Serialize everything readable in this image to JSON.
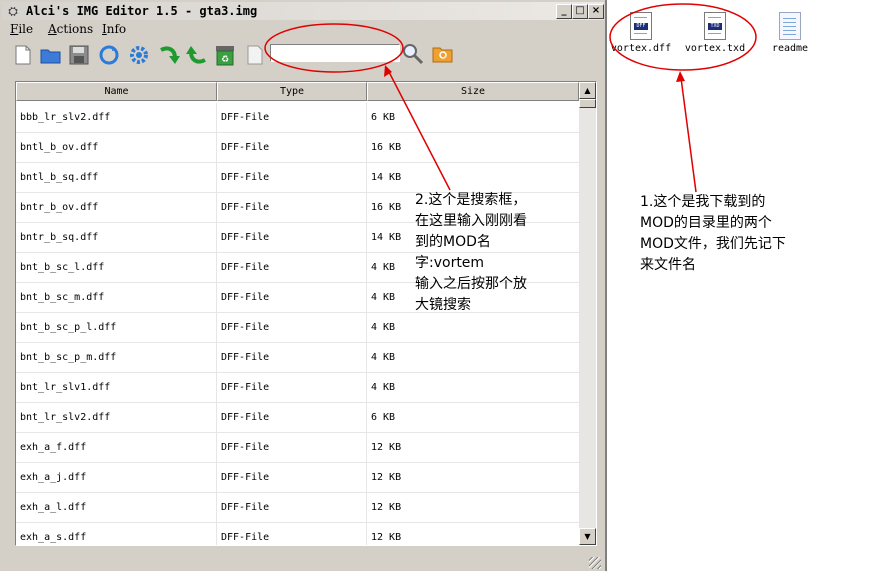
{
  "window": {
    "title": "Alci's IMG Editor 1.5 - gta3.img",
    "buttons": {
      "minimize": "_",
      "maximize": "□",
      "close": "×"
    }
  },
  "menu": [
    "File",
    "Actions",
    "Info"
  ],
  "toolbar": {
    "icons": [
      "new-file-icon",
      "open-folder-icon",
      "save-icon",
      "refresh-icon",
      "settings-gear-icon",
      "import-arrow-icon",
      "export-arrow-icon",
      "rebuild-recycle-icon",
      "new-doc-icon"
    ],
    "search_value": "",
    "search_icon": "magnifier-icon",
    "find_icon": "folder-search-icon"
  },
  "table": {
    "columns": [
      "Name",
      "Type",
      "Size"
    ],
    "rows": [
      [
        "bbb_lr_slv2.dff",
        "DFF-File",
        "6 KB"
      ],
      [
        "bntl_b_ov.dff",
        "DFF-File",
        "16 KB"
      ],
      [
        "bntl_b_sq.dff",
        "DFF-File",
        "14 KB"
      ],
      [
        "bntr_b_ov.dff",
        "DFF-File",
        "16 KB"
      ],
      [
        "bntr_b_sq.dff",
        "DFF-File",
        "14 KB"
      ],
      [
        "bnt_b_sc_l.dff",
        "DFF-File",
        "4 KB"
      ],
      [
        "bnt_b_sc_m.dff",
        "DFF-File",
        "4 KB"
      ],
      [
        "bnt_b_sc_p_l.dff",
        "DFF-File",
        "4 KB"
      ],
      [
        "bnt_b_sc_p_m.dff",
        "DFF-File",
        "4 KB"
      ],
      [
        "bnt_lr_slv1.dff",
        "DFF-File",
        "4 KB"
      ],
      [
        "bnt_lr_slv2.dff",
        "DFF-File",
        "6 KB"
      ],
      [
        "exh_a_f.dff",
        "DFF-File",
        "12 KB"
      ],
      [
        "exh_a_j.dff",
        "DFF-File",
        "12 KB"
      ],
      [
        "exh_a_l.dff",
        "DFF-File",
        "12 KB"
      ],
      [
        "exh_a_s.dff",
        "DFF-File",
        "12 KB"
      ]
    ]
  },
  "desktop_files": [
    {
      "name": "vortex.dff",
      "badge": "DFF"
    },
    {
      "name": "vortex.txd",
      "badge": "TXD"
    },
    {
      "name": "readme",
      "badge": ""
    }
  ],
  "annotations": {
    "note1": "1.这个是我下载到的\nMOD的目录里的两个\nMOD文件，我们先记下\n来文件名",
    "note2": "2.这个是搜索框，\n在这里输入刚刚看\n到的MOD名\n字:vortem\n输入之后按那个放\n大镜搜索",
    "color": "#e00000"
  }
}
